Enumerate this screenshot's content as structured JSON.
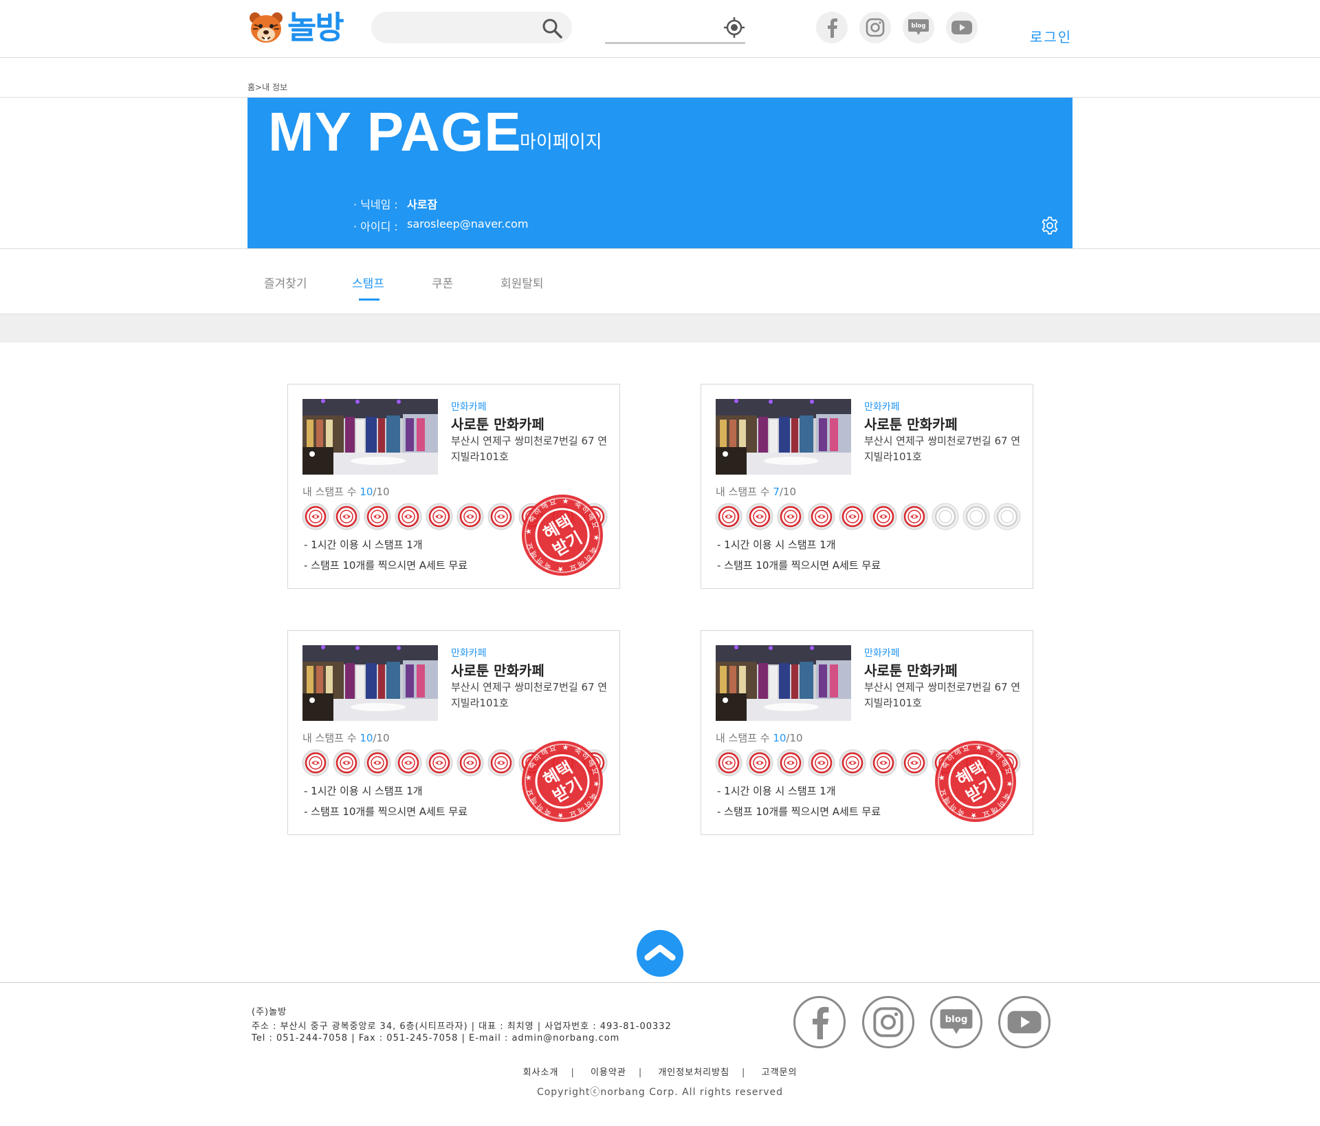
{
  "header": {
    "logo_text": "놀방",
    "search": {
      "value": "",
      "placeholder": ""
    },
    "location": {
      "value": "",
      "placeholder": ""
    },
    "social_icons": [
      "facebook-icon",
      "instagram-icon",
      "blog-icon",
      "youtube-icon"
    ],
    "login_label": "로그인"
  },
  "breadcrumb": "홈>내 정보",
  "hero": {
    "title": "MY PAGE",
    "subtitle": "마이페이지",
    "nickname_label": "· 닉네임 :",
    "nickname_value": "사로잠",
    "id_label": "· 아이디 :",
    "id_value": "sarosleep@naver.com"
  },
  "tabs": [
    {
      "label": "즐겨찾기",
      "active": false
    },
    {
      "label": "스탬프",
      "active": true
    },
    {
      "label": "쿠폰",
      "active": false
    },
    {
      "label": "회원탈퇴",
      "active": false
    }
  ],
  "cards": [
    {
      "category": "만화카페",
      "name": "사로툰 만화카페",
      "address": "부산시 연제구 쌍미천로7번길 67 연지빌라101호",
      "count_label": "내 스탬프 수",
      "stamps": 10,
      "total": 10,
      "count_total_text": "/10",
      "rule1": "- 1시간 이용 시 스탬프 1개",
      "rule2": "- 스탬프 10개를 찍으시면 A세트 무료",
      "benefit": {
        "big_text_1": "혜택",
        "big_text_2": "받기",
        "ring_text": "★ 축하해요 ★ 축하해요"
      }
    },
    {
      "category": "만화카페",
      "name": "사로툰 만화카페",
      "address": "부산시 연제구 쌍미천로7번길 67 연지빌라101호",
      "count_label": "내 스탬프 수",
      "stamps": 7,
      "total": 10,
      "count_total_text": "/10",
      "rule1": "- 1시간 이용 시 스탬프 1개",
      "rule2": "- 스탬프 10개를 찍으시면 A세트 무료",
      "benefit": null
    },
    {
      "category": "만화카페",
      "name": "사로툰 만화카페",
      "address": "부산시 연제구 쌍미천로7번길 67 연지빌라101호",
      "count_label": "내 스탬프 수",
      "stamps": 10,
      "total": 10,
      "count_total_text": "/10",
      "rule1": "- 1시간 이용 시 스탬프 1개",
      "rule2": "- 스탬프 10개를 찍으시면 A세트 무료",
      "benefit": {
        "big_text_1": "혜택",
        "big_text_2": "받기",
        "ring_text": "★ 축하해요 ★ 축하해요"
      }
    },
    {
      "category": "만화카페",
      "name": "사로툰 만화카페",
      "address": "부산시 연제구 쌍미천로7번길 67 연지빌라101호",
      "count_label": "내 스탬프 수",
      "stamps": 10,
      "total": 10,
      "count_total_text": "/10",
      "rule1": "- 1시간 이용 시 스탬프 1개",
      "rule2": "- 스탬프 10개를 찍으시면 A세트 무료",
      "benefit": {
        "big_text_1": "혜택",
        "big_text_2": "받기",
        "ring_text": "★ 축하해요 ★ 축하해요"
      }
    }
  ],
  "footer": {
    "company": "(주)놀방",
    "address_line": "주소 : 부산시 중구 광복중앙로 34, 6층(시티프라자)  |  대표 : 최치영  |  사업자번호 : 493-81-00332",
    "contact_line": "Tel : 051-244-7058  |  Fax : 051-245-7058  |  E-mail : admin@norbang.com",
    "links": [
      "회사소개",
      "이용약관",
      "개인정보처리방침",
      "고객문의"
    ],
    "copyright": "Copyrightⓒnorbang Corp. All rights reserved",
    "social_icons": [
      "facebook-icon",
      "instagram-icon",
      "blog-icon",
      "youtube-icon"
    ]
  },
  "colors": {
    "accent": "#2196f3",
    "stamp_red": "#d8272d",
    "stamp_empty": "#d0d0d0"
  }
}
